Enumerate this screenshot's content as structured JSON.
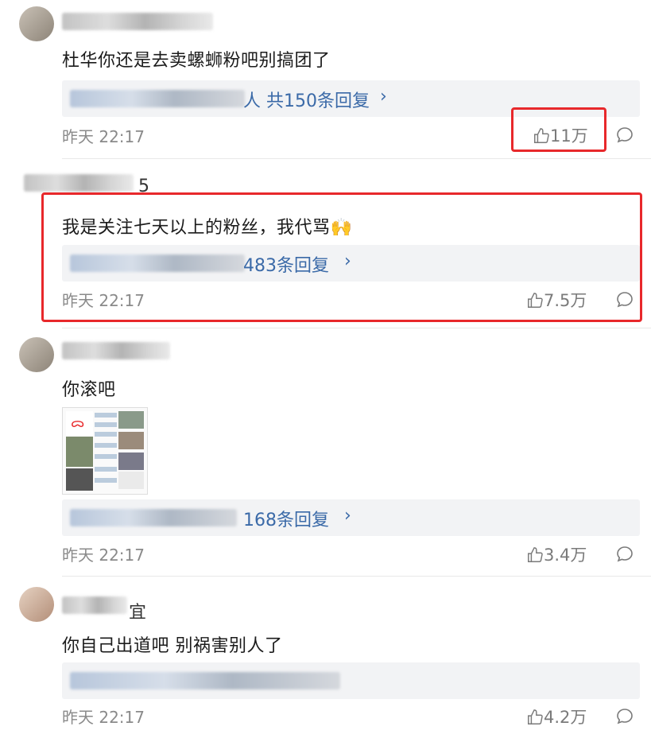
{
  "comments": [
    {
      "text": "杜华你还是去卖螺蛳粉吧别搞团了",
      "reply_visible": "人 共150条回复",
      "time": "昨天 22:17",
      "likes": "11万"
    },
    {
      "username_tail": "5",
      "text": "我是关注七天以上的粉丝，我代骂🙌",
      "reply_visible": "483条回复",
      "time": "昨天 22:17",
      "likes": "7.5万"
    },
    {
      "text": "你滚吧",
      "reply_visible": "168条回复",
      "time": "昨天 22:17",
      "likes": "3.4万"
    },
    {
      "username_tail": "宜",
      "text": "你自己出道吧 别祸害别人了",
      "time": "昨天 22:17",
      "likes": "4.2万"
    }
  ],
  "icons": {
    "like": "thumbs-up-icon",
    "comment": "comment-bubble-icon"
  },
  "colors": {
    "highlight": "#e8282b",
    "link": "#3b6aa8",
    "meta": "#8a8a8a"
  }
}
